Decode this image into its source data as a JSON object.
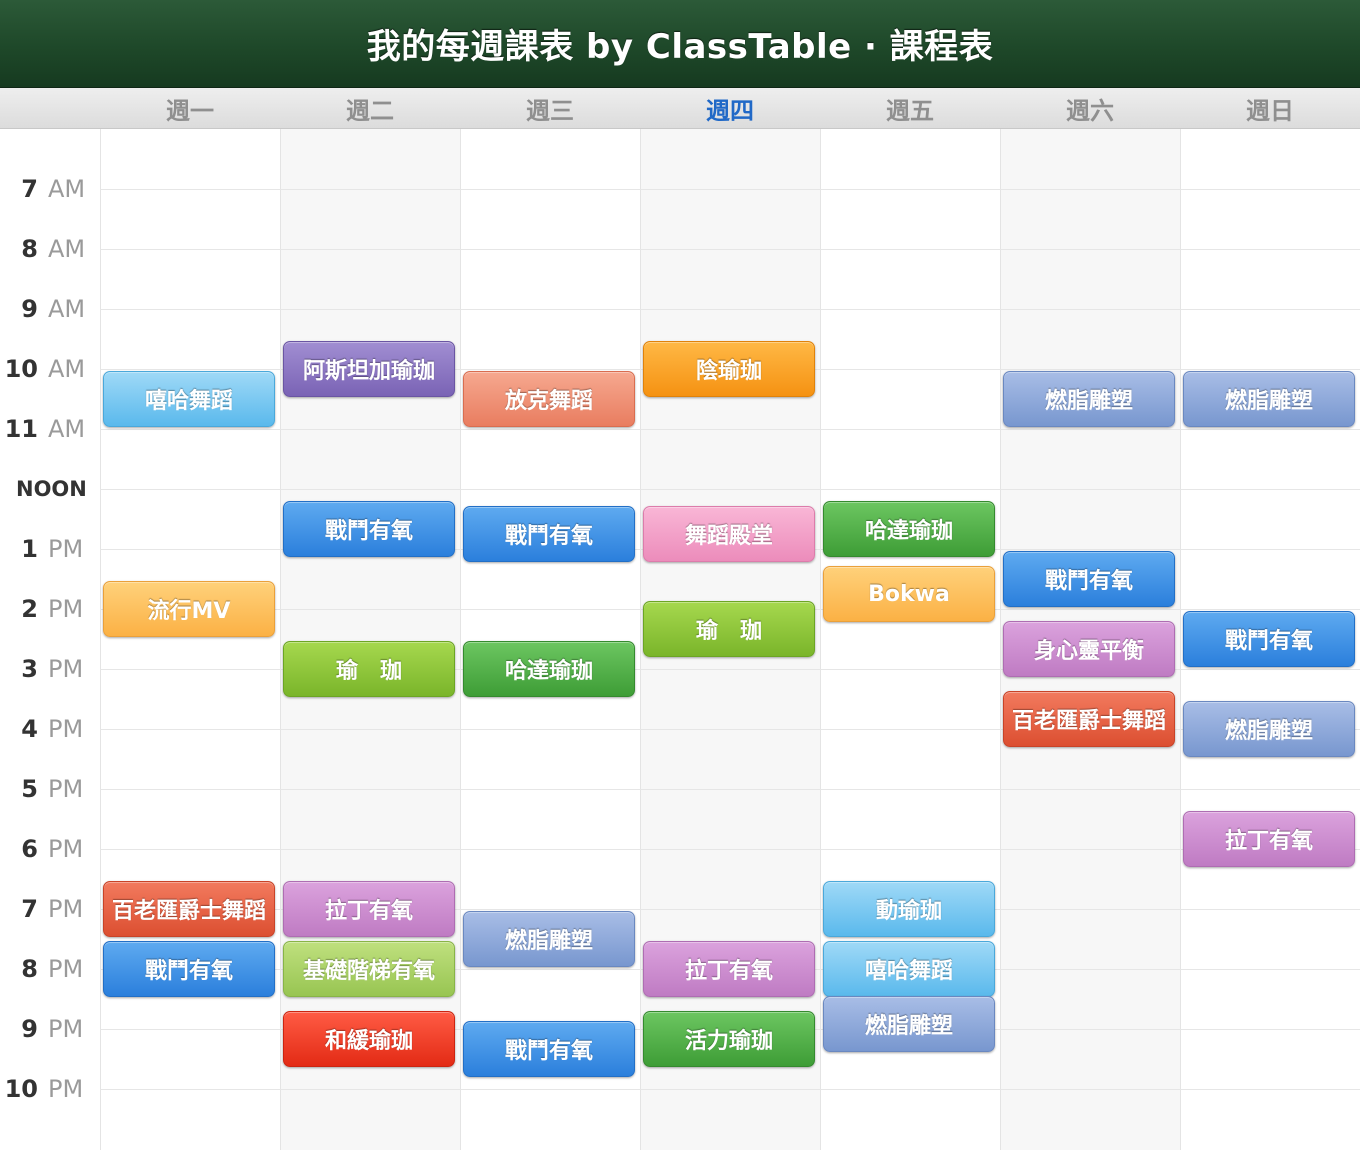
{
  "header": {
    "title": "我的每週課表 by ClassTable · 課程表"
  },
  "days": [
    {
      "label": "週一",
      "today": false
    },
    {
      "label": "週二",
      "today": false
    },
    {
      "label": "週三",
      "today": false
    },
    {
      "label": "週四",
      "today": true
    },
    {
      "label": "週五",
      "today": false
    },
    {
      "label": "週六",
      "today": false
    },
    {
      "label": "週日",
      "today": false
    }
  ],
  "hours": [
    {
      "num": "7",
      "ap": "AM"
    },
    {
      "num": "8",
      "ap": "AM"
    },
    {
      "num": "9",
      "ap": "AM"
    },
    {
      "num": "10",
      "ap": "AM"
    },
    {
      "num": "11",
      "ap": "AM"
    },
    {
      "num": "",
      "ap": "NOON"
    },
    {
      "num": "1",
      "ap": "PM"
    },
    {
      "num": "2",
      "ap": "PM"
    },
    {
      "num": "3",
      "ap": "PM"
    },
    {
      "num": "4",
      "ap": "PM"
    },
    {
      "num": "5",
      "ap": "PM"
    },
    {
      "num": "6",
      "ap": "PM"
    },
    {
      "num": "7",
      "ap": "PM"
    },
    {
      "num": "8",
      "ap": "PM"
    },
    {
      "num": "9",
      "ap": "PM"
    },
    {
      "num": "10",
      "ap": "PM"
    }
  ],
  "events": [
    {
      "day": 0,
      "start": 10.0,
      "label": "嘻哈舞蹈",
      "color": "lightblue"
    },
    {
      "day": 0,
      "start": 13.5,
      "label": "流行MV",
      "color": "ltorange"
    },
    {
      "day": 0,
      "start": 18.5,
      "label": "百老匯爵士舞蹈",
      "color": "red"
    },
    {
      "day": 0,
      "start": 19.5,
      "label": "戰鬥有氧",
      "color": "blue"
    },
    {
      "day": 1,
      "start": 9.5,
      "label": "阿斯坦加瑜珈",
      "color": "purple"
    },
    {
      "day": 1,
      "start": 12.17,
      "label": "戰鬥有氧",
      "color": "blue"
    },
    {
      "day": 1,
      "start": 14.5,
      "label": "瑜　珈",
      "color": "lime"
    },
    {
      "day": 1,
      "start": 18.5,
      "label": "拉丁有氧",
      "color": "mauve"
    },
    {
      "day": 1,
      "start": 19.5,
      "label": "基礎階梯有氧",
      "color": "lightlime"
    },
    {
      "day": 1,
      "start": 20.67,
      "label": "和緩瑜珈",
      "color": "red2"
    },
    {
      "day": 2,
      "start": 10.0,
      "label": "放克舞蹈",
      "color": "salmon"
    },
    {
      "day": 2,
      "start": 12.25,
      "label": "戰鬥有氧",
      "color": "blue"
    },
    {
      "day": 2,
      "start": 14.5,
      "label": "哈達瑜珈",
      "color": "green"
    },
    {
      "day": 2,
      "start": 19.0,
      "label": "燃脂雕塑",
      "color": "steel"
    },
    {
      "day": 2,
      "start": 20.83,
      "label": "戰鬥有氧",
      "color": "blue"
    },
    {
      "day": 3,
      "start": 9.5,
      "label": "陰瑜珈",
      "color": "orange"
    },
    {
      "day": 3,
      "start": 12.25,
      "label": "舞蹈殿堂",
      "color": "pink"
    },
    {
      "day": 3,
      "start": 13.83,
      "label": "瑜　珈",
      "color": "lime"
    },
    {
      "day": 3,
      "start": 19.5,
      "label": "拉丁有氧",
      "color": "mauve"
    },
    {
      "day": 3,
      "start": 20.67,
      "label": "活力瑜珈",
      "color": "green"
    },
    {
      "day": 4,
      "start": 12.17,
      "label": "哈達瑜珈",
      "color": "green"
    },
    {
      "day": 4,
      "start": 13.25,
      "label": "Bokwa",
      "color": "ltorange"
    },
    {
      "day": 4,
      "start": 18.5,
      "label": "動瑜珈",
      "color": "lightblue"
    },
    {
      "day": 4,
      "start": 19.5,
      "label": "嘻哈舞蹈",
      "color": "lightblue"
    },
    {
      "day": 4,
      "start": 20.42,
      "label": "燃脂雕塑",
      "color": "steel"
    },
    {
      "day": 5,
      "start": 10.0,
      "label": "燃脂雕塑",
      "color": "steel"
    },
    {
      "day": 5,
      "start": 13.0,
      "label": "戰鬥有氧",
      "color": "blue"
    },
    {
      "day": 5,
      "start": 14.17,
      "label": "身心靈平衡",
      "color": "mauve"
    },
    {
      "day": 5,
      "start": 15.33,
      "label": "百老匯爵士舞蹈",
      "color": "red"
    },
    {
      "day": 6,
      "start": 10.0,
      "label": "燃脂雕塑",
      "color": "steel"
    },
    {
      "day": 6,
      "start": 14.0,
      "label": "戰鬥有氧",
      "color": "blue"
    },
    {
      "day": 6,
      "start": 15.5,
      "label": "燃脂雕塑",
      "color": "steel"
    },
    {
      "day": 6,
      "start": 17.33,
      "label": "拉丁有氧",
      "color": "mauve"
    }
  ]
}
